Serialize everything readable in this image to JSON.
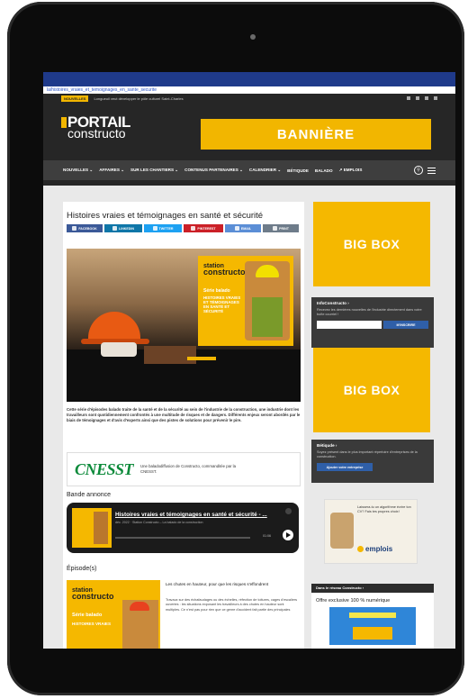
{
  "browser": {
    "url": "la/histoires_vraies_et_temoignages_en_sante_securite"
  },
  "topbar": {
    "news_tag": "NOUVELLES",
    "news_text": "Longueuil veut développer le pôle culturel Saint-Charles"
  },
  "logo": {
    "line1": "PORTAIL",
    "line2": "constructo"
  },
  "banner": {
    "label": "BANNIÈRE"
  },
  "nav": {
    "items": [
      "NOUVELLES ⌄",
      "AFFAIRES ⌄",
      "SUR LES CHANTIERS ⌄",
      "CONTENUS PARTENAIRES ⌄",
      "CALENDRIER ⌄",
      "BÉTIQUDE",
      "BALADO",
      "↗ EMPLOIS"
    ],
    "search_glyph": "⚲"
  },
  "article": {
    "title": "Histoires vraies et témoignages en santé et sécurité",
    "share_buttons": [
      {
        "label": "FACEBOOK",
        "color": "#3b5998"
      },
      {
        "label": "LINKEDIN",
        "color": "#0e76a8"
      },
      {
        "label": "TWITTER",
        "color": "#1da1f2"
      },
      {
        "label": "PINTEREST",
        "color": "#cb2027"
      },
      {
        "label": "EMAIL",
        "color": "#5b8ed6"
      },
      {
        "label": "PRINT",
        "color": "#6e7c8a"
      }
    ],
    "poster": {
      "brand_top": "station",
      "brand_bottom": "constructo",
      "series": "Série balado",
      "title": "HISTOIRES VRAIES ET TÉMOIGNAGES EN SANTÉ ET SÉCURITÉ"
    },
    "description": "Cette série d'épisodes balado traite de la santé et de la sécurité au sein de l'industrie de la construction, une industrie dont les travailleurs sont quotidiennement confrontés à une multitude de risques et de dangers. Différents enjeux seront abordés par le biais de témoignages et d'avis d'experts ainsi que des pistes de solutions pour prévenir le pire.",
    "sponsor": {
      "logo": "CNESST",
      "text": "Une baladodiffusion de Constructo, commanditée par la CNESST."
    },
    "trailer_heading": "Bande annonce",
    "player": {
      "title": "Histoires vraies et témoignages en santé et sécurité - ...",
      "subtitle": "déc. 2022 · Station Constructo – La balado de la construction",
      "time": "01:06"
    },
    "episodes_heading": "Épisode(s)",
    "episode": {
      "brand_top": "station",
      "brand_bottom": "constructo",
      "series": "Série balado",
      "tag": "HISTOIRES VRAIES",
      "title": "Les chutes en hauteur, pour que les risques s'effondrent",
      "text": "Travaux sur des échafaudages ou des échelles, réfection de toitures, cages d'escaliers ouvertes : les situations exposant les travailleurs à des chutes en hauteur sont multiples. Ce n'est pas pour rien que ce genre d'accident fait partie des principales"
    }
  },
  "sidebar": {
    "bigbox1": "BIG BOX",
    "bigbox2": "BIG BOX",
    "infoconstructo": {
      "title": "InfoConstructo ›",
      "text": "Recevez les dernières nouvelles de l'industrie directement dans votre boîte courriel !",
      "button": "M'INSCRIRE"
    },
    "betiqude": {
      "title": "Bétiqude ›",
      "text": "Soyez présent dans le plus important répertoire d'entreprises de la construction.",
      "button": "Ajouter votre entreprise"
    },
    "emplois": {
      "text": "Laissera-tu un algorithme écrire ton CV? Fais tes propres choix!",
      "logo": "emplois"
    },
    "reseau": "Dans le réseau Constructo ›",
    "offre": "Offre exclusive 100 % numérique"
  },
  "colors": {
    "accent": "#f5b800",
    "dark": "#262626",
    "nav": "#3e3e3e"
  }
}
